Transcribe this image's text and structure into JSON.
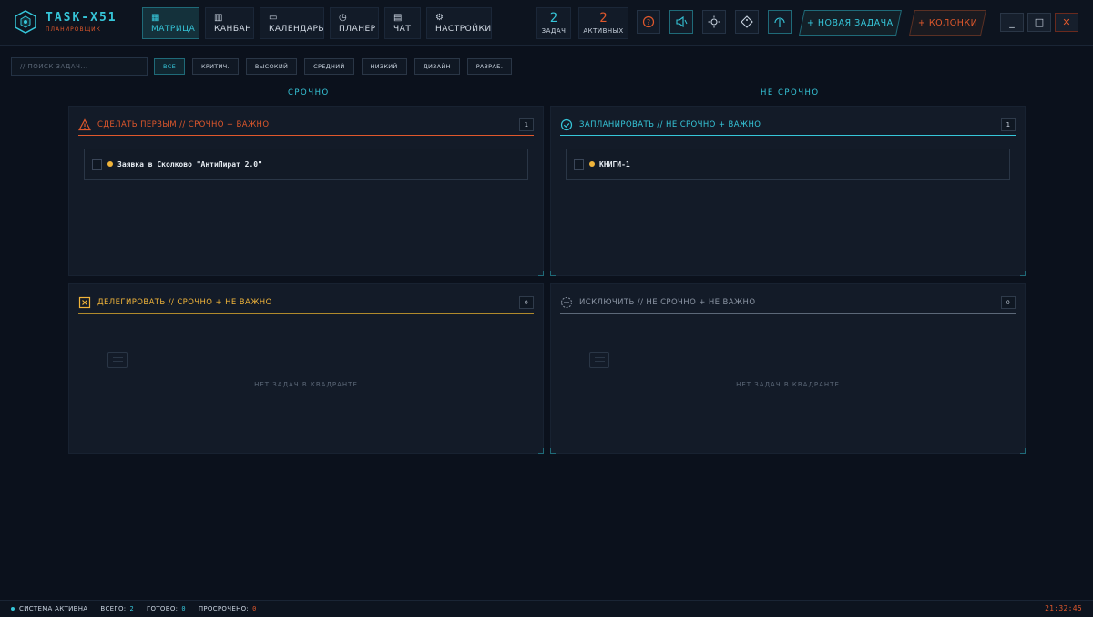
{
  "app": {
    "title": "TASK-X51",
    "subtitle": "ПЛАНИРОВЩИК"
  },
  "nav": [
    {
      "label": "МАТРИЦА",
      "icon": "grid-icon",
      "glyph": "▦",
      "active": true
    },
    {
      "label": "КАНБАН",
      "icon": "kanban-icon",
      "glyph": "▥",
      "active": false
    },
    {
      "label": "КАЛЕНДАРЬ",
      "icon": "calendar-icon",
      "glyph": "▭",
      "active": false
    },
    {
      "label": "ПЛАНЕР",
      "icon": "clock-icon",
      "glyph": "◷",
      "active": false
    },
    {
      "label": "ЧАТ",
      "icon": "chat-icon",
      "glyph": "▤",
      "active": false
    },
    {
      "label": "НАСТРОЙКИ",
      "icon": "settings-icon",
      "glyph": "⚙",
      "active": false
    }
  ],
  "counters": {
    "tasks": {
      "value": "2",
      "label": "ЗАДАЧ"
    },
    "active": {
      "value": "2",
      "label": "АКТИВНЫХ"
    }
  },
  "toolbar": {
    "help": "?",
    "sound": "◁)",
    "theme": "☼",
    "tag": "◇",
    "sync": "↑",
    "new_task": "+ НОВАЯ ЗАДАЧА",
    "columns": "+ КОЛОНКИ"
  },
  "window": {
    "minimize": "_",
    "maximize": "□",
    "close": "✕"
  },
  "search": {
    "placeholder": "// ПОИСК ЗАДАЧ..."
  },
  "filters": [
    "ВСЕ",
    "КРИТИЧ.",
    "ВЫСОКИЙ",
    "СРЕДНИЙ",
    "НИЗКИЙ",
    "ДИЗАЙН",
    "РАЗРАБ."
  ],
  "columns": {
    "urgent": "СРОЧНО",
    "not_urgent": "НЕ СРОЧНО"
  },
  "quadrants": {
    "do_first": {
      "title": "СДЕЛАТЬ ПЕРВЫМ // СРОЧНО + ВАЖНО",
      "count": "1",
      "color": "#e0582c",
      "tasks": [
        {
          "title": "Заявка в Сколково \"АнтиПират 2.0\""
        }
      ]
    },
    "schedule": {
      "title": "ЗАПЛАНИРОВАТЬ // НЕ СРОЧНО + ВАЖНО",
      "count": "1",
      "color": "#36c6d9",
      "tasks": [
        {
          "title": "КНИГИ-1"
        }
      ]
    },
    "delegate": {
      "title": "ДЕЛЕГИРОВАТЬ // СРОЧНО + НЕ ВАЖНО",
      "count": "0",
      "color": "#f0b43a",
      "empty": "НЕТ ЗАДАЧ В КВАДРАНТЕ"
    },
    "eliminate": {
      "title": "ИСКЛЮЧИТЬ // НЕ СРОЧНО + НЕ ВАЖНО",
      "count": "0",
      "color": "#8a94a3",
      "empty": "НЕТ ЗАДАЧ В КВАДРАНТЕ"
    }
  },
  "status": {
    "system": "СИСТЕМА АКТИВНА",
    "total_label": "ВСЕГО:",
    "total": "2",
    "done_label": "ГОТОВО:",
    "done": "0",
    "overdue_label": "ПРОСРОЧЕНО:",
    "overdue": "0",
    "clock": "21:32:45"
  }
}
